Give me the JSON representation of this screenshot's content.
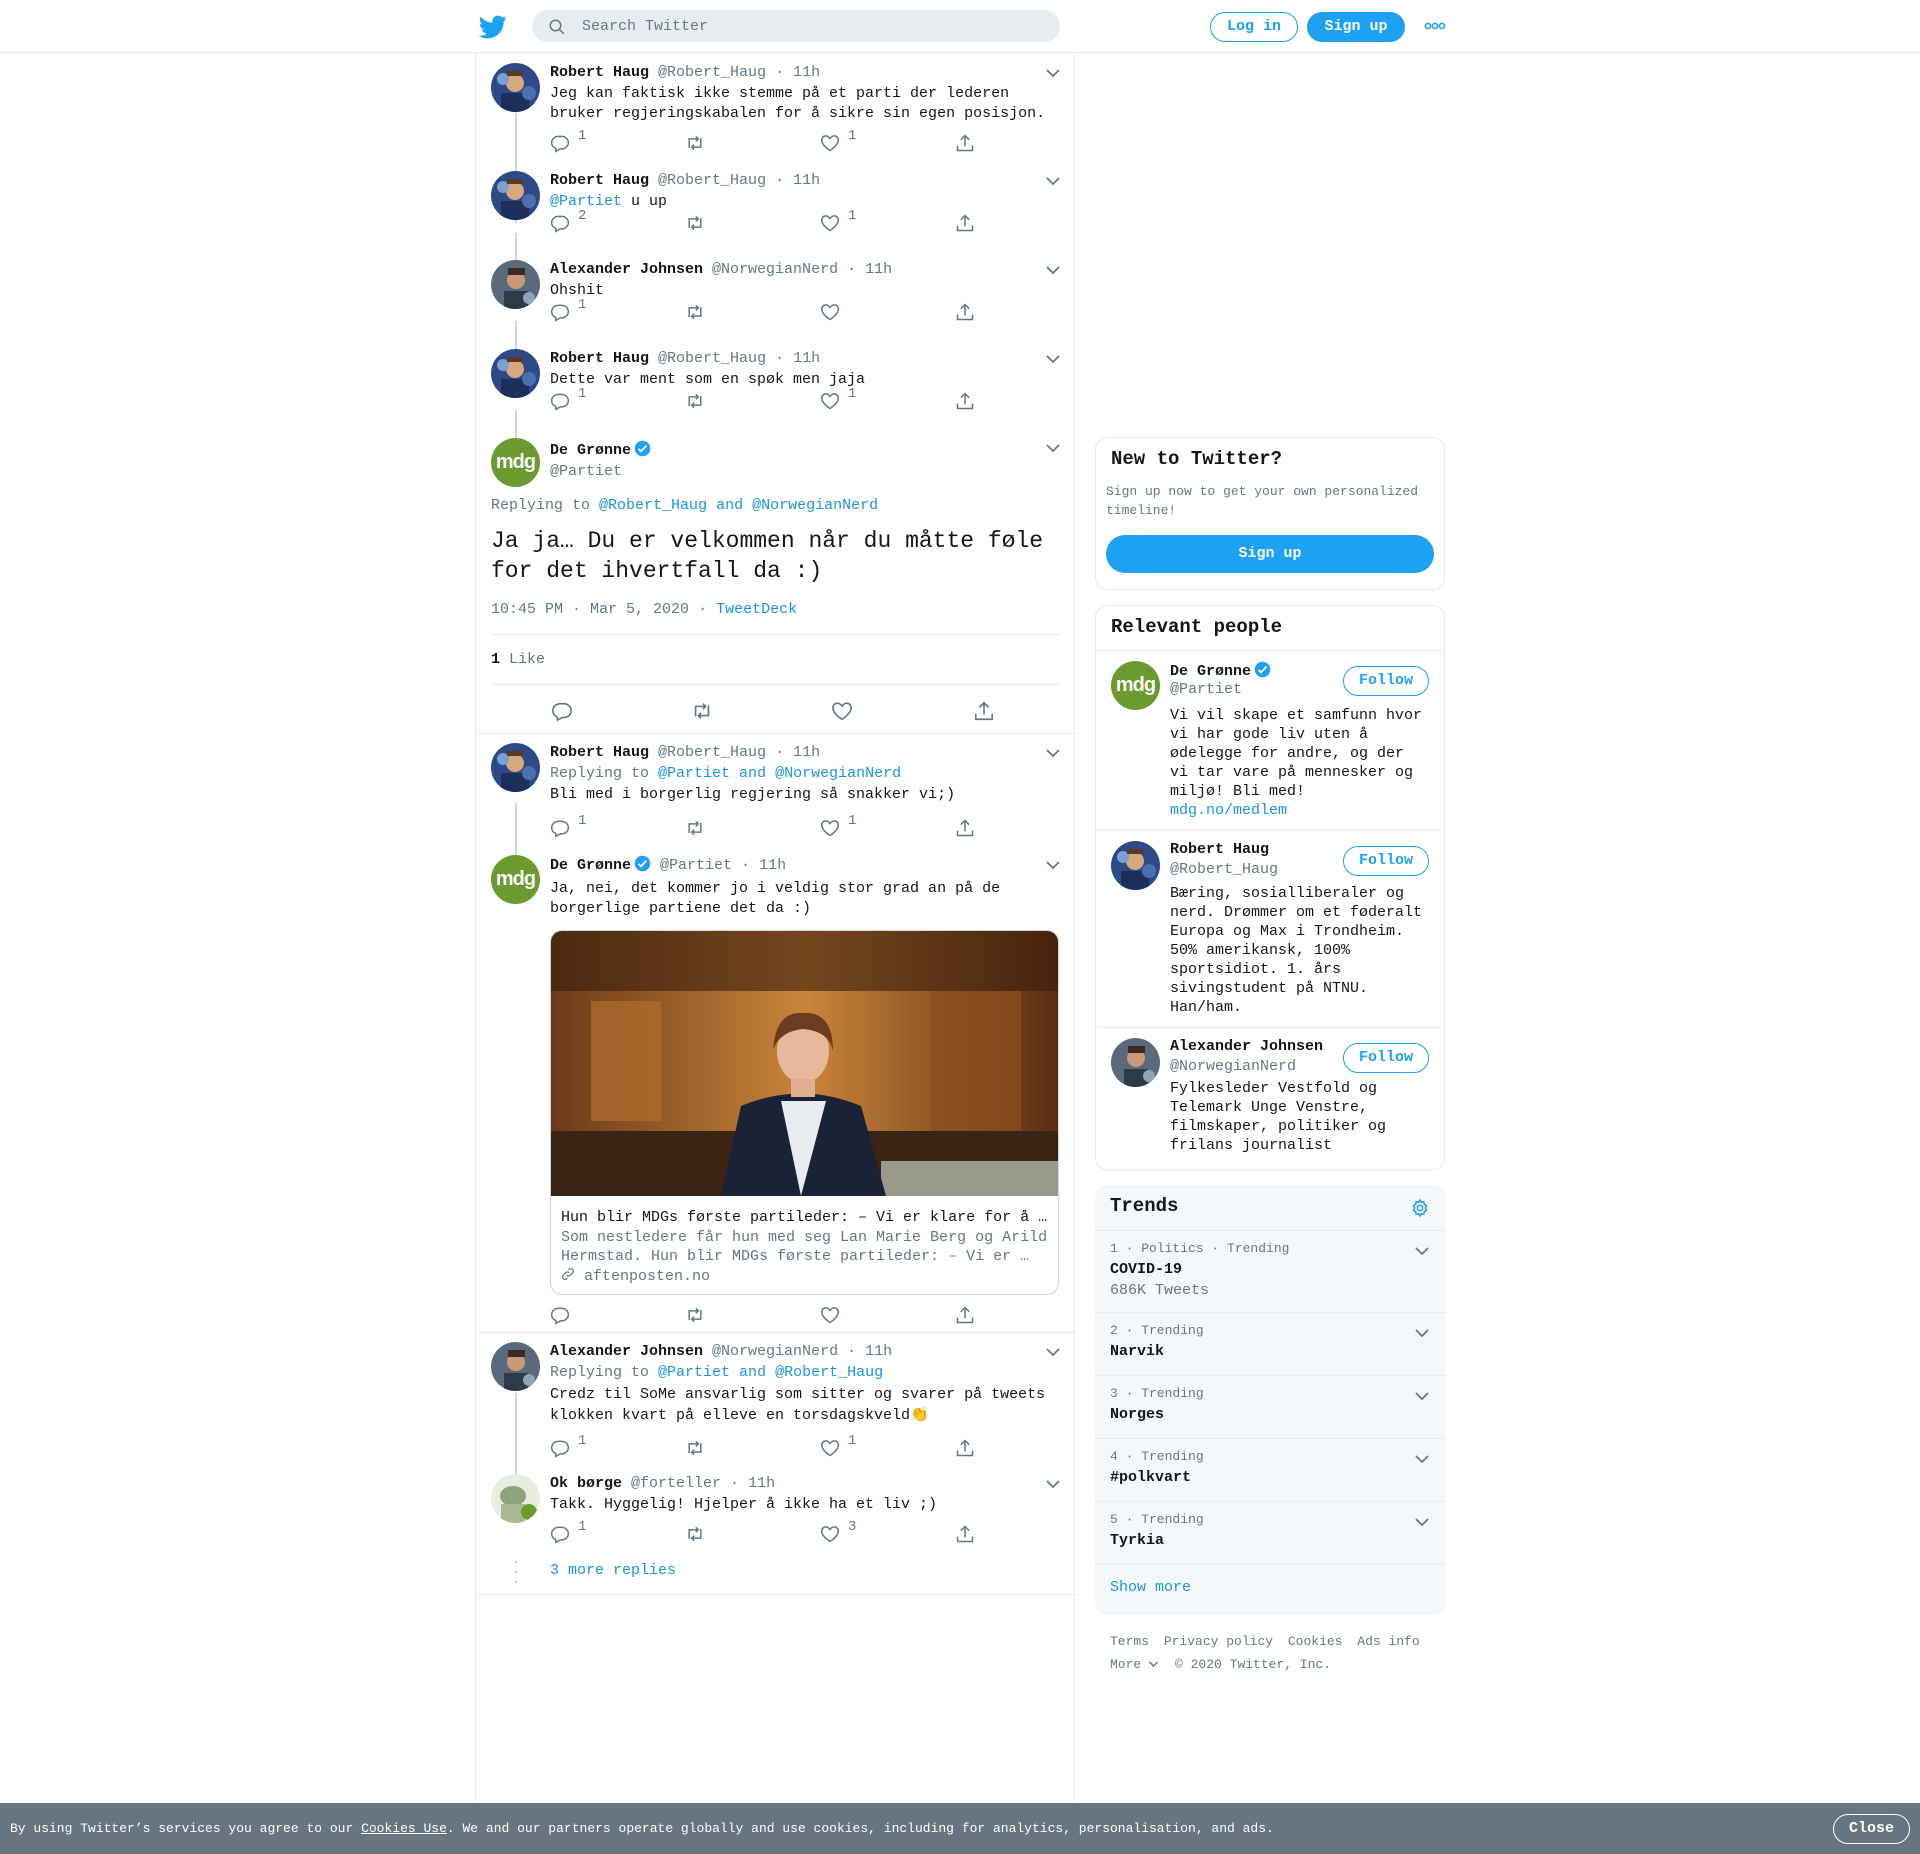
{
  "header": {
    "search_placeholder": "Search Twitter",
    "login_label": "Log in",
    "signup_label": "Sign up"
  },
  "thread": [
    {
      "name": "Robert Haug",
      "handle": "@Robert_Haug",
      "time": "11h",
      "text": "Jeg kan faktisk ikke stemme på et parti der lederen bruker regjeringskabalen for å sikre sin egen posisjon.",
      "replies": "1",
      "retweets": "",
      "likes": "1"
    },
    {
      "name": "Robert Haug",
      "handle": "@Robert_Haug",
      "time": "11h",
      "mention": "@Partiet",
      "text": " u up",
      "replies": "2",
      "retweets": "",
      "likes": "1"
    },
    {
      "name": "Alexander Johnsen",
      "handle": "@NorwegianNerd",
      "time": "11h",
      "text": "Ohshit",
      "replies": "1",
      "retweets": "",
      "likes": ""
    },
    {
      "name": "Robert Haug",
      "handle": "@Robert_Haug",
      "time": "11h",
      "text": "Dette var ment som en spøk men jaja",
      "replies": "1",
      "retweets": "",
      "likes": "1"
    }
  ],
  "focus": {
    "name": "De Grønne",
    "handle": "@Partiet",
    "avatar_text": "mdg",
    "replying_prefix": "Replying to",
    "replying_to": "@Robert_Haug and @NorwegianNerd",
    "text": "Ja ja… Du er velkommen når du måtte føle for det ihvertfall da :)",
    "timestamp": "10:45 PM · Mar 5, 2020",
    "source_sep": "·",
    "source": "TweetDeck",
    "like_count": "1",
    "like_label": "Like"
  },
  "replies": [
    {
      "name": "Robert Haug",
      "handle": "@Robert_Haug",
      "time": "11h",
      "replying_prefix": "Replying to",
      "replying_to": "@Partiet and @NorwegianNerd",
      "text": "Bli med i borgerlig regjering så snakker vi;)",
      "replies": "1",
      "likes": "1"
    },
    {
      "name": "De Grønne",
      "handle": "@Partiet",
      "time": "11h",
      "text": "Ja, nei, det kommer jo i veldig stor grad an på de borgerlige partiene det da :)",
      "card": {
        "title": "Hun blir MDGs første partileder: – Vi er klare for å …",
        "desc": "Som nestledere får hun med seg Lan Marie Berg og Arild Hermstad. Hun blir MDGs første partileder: – Vi er …",
        "domain": "aftenposten.no"
      }
    },
    {
      "name": "Alexander Johnsen",
      "handle": "@NorwegianNerd",
      "time": "11h",
      "replying_prefix": "Replying to",
      "replying_to": "@Partiet and @Robert_Haug",
      "text": "Credz til SoMe ansvarlig som sitter og svarer på tweets klokken kvart på elleve en torsdagskveld👏",
      "replies": "1",
      "likes": "1"
    },
    {
      "name": "Ok børge",
      "handle": "@forteller",
      "time": "11h",
      "text": "Takk. Hyggelig! Hjelper å ikke ha et liv ;)",
      "replies": "1",
      "likes": "3"
    }
  ],
  "more_replies": "3 more replies",
  "sidebar": {
    "new_title": "New to Twitter?",
    "new_sub": "Sign up now to get your own personalized timeline!",
    "new_signup": "Sign up",
    "relevant_title": "Relevant people",
    "follow_label": "Follow",
    "people": [
      {
        "name": "De Grønne",
        "handle": "@Partiet",
        "bio": "Vi vil skape et samfunn hvor vi har gode liv uten å ødelegge for andre, og der vi tar vare på mennesker og miljø! Bli med!",
        "link": "mdg.no/medlem"
      },
      {
        "name": "Robert Haug",
        "handle": "@Robert_Haug",
        "bio": "Bæring, sosialliberaler og nerd. Drømmer om et føderalt Europa og Max i Trondheim. 50% amerikansk, 100% sportsidiot. 1. års sivingstudent på NTNU. Han/ham."
      },
      {
        "name": "Alexander Johnsen",
        "handle": "@NorwegianNerd",
        "bio": "Fylkesleder Vestfold og Telemark Unge Venstre, filmskaper, politiker og frilans journalist"
      }
    ],
    "trends_title": "Trends",
    "trends": [
      {
        "meta": "1 · Politics · Trending",
        "name": "COVID-19",
        "count": "686K Tweets"
      },
      {
        "meta": "2 · Trending",
        "name": "Narvik"
      },
      {
        "meta": "3 · Trending",
        "name": "Norges"
      },
      {
        "meta": "4 · Trending",
        "name": "#polkvart"
      },
      {
        "meta": "5 · Trending",
        "name": "Tyrkia"
      }
    ],
    "show_more": "Show more",
    "footer": {
      "terms": "Terms",
      "privacy": "Privacy policy",
      "cookies": "Cookies",
      "ads": "Ads info",
      "more": "More",
      "copyright": "© 2020 Twitter, Inc."
    }
  },
  "cookie": {
    "text_before": "By using Twitter’s services you agree to our ",
    "link": "Cookies Use",
    "text_after": ". We and our partners operate globally and use cookies, including for analytics, personalisation, and ads.",
    "close_label": "Close"
  },
  "colors": {
    "accent": "#1da1f2",
    "link": "#1b95e0",
    "mdg_green": "#6b9a2f",
    "cookie_bar": "#66757f"
  }
}
